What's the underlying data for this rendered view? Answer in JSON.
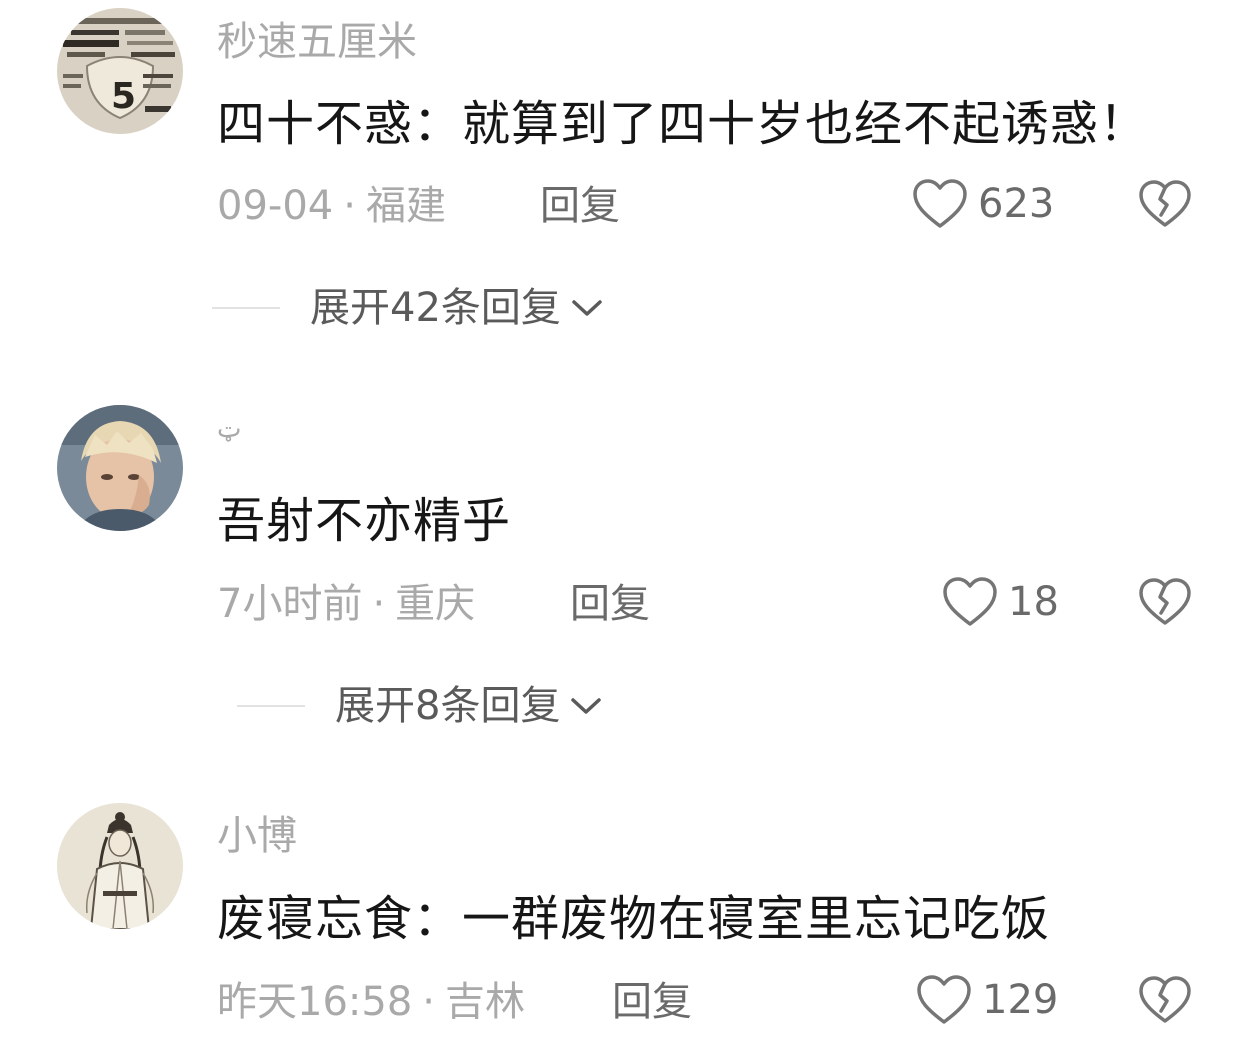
{
  "comments": [
    {
      "username": "秒速五厘米",
      "text": "四十不惑：就算到了四十岁也经不起诱惑！",
      "time": "09-04",
      "location": "福建",
      "reply_label": "回复",
      "likes": "623",
      "expand_label": "展开42条回复",
      "avatar_text": "5"
    },
    {
      "username": "ټ",
      "text": "吾射不亦精乎",
      "time": "7小时前",
      "location": "重庆",
      "reply_label": "回复",
      "likes": "18",
      "expand_label": "展开8条回复"
    },
    {
      "username": "小博",
      "text": "废寝忘食：一群废物在寝室里忘记吃饭",
      "time": "昨天16:58",
      "location": "吉林",
      "reply_label": "回复",
      "likes": "129"
    }
  ],
  "meta_separator": "·",
  "icons": {
    "like": "heart-outline-icon",
    "dislike": "broken-heart-icon",
    "expand": "chevron-down-icon"
  },
  "colors": {
    "text_primary": "#161616",
    "text_secondary": "#a9a9a9",
    "text_action": "#6a6a6a"
  }
}
